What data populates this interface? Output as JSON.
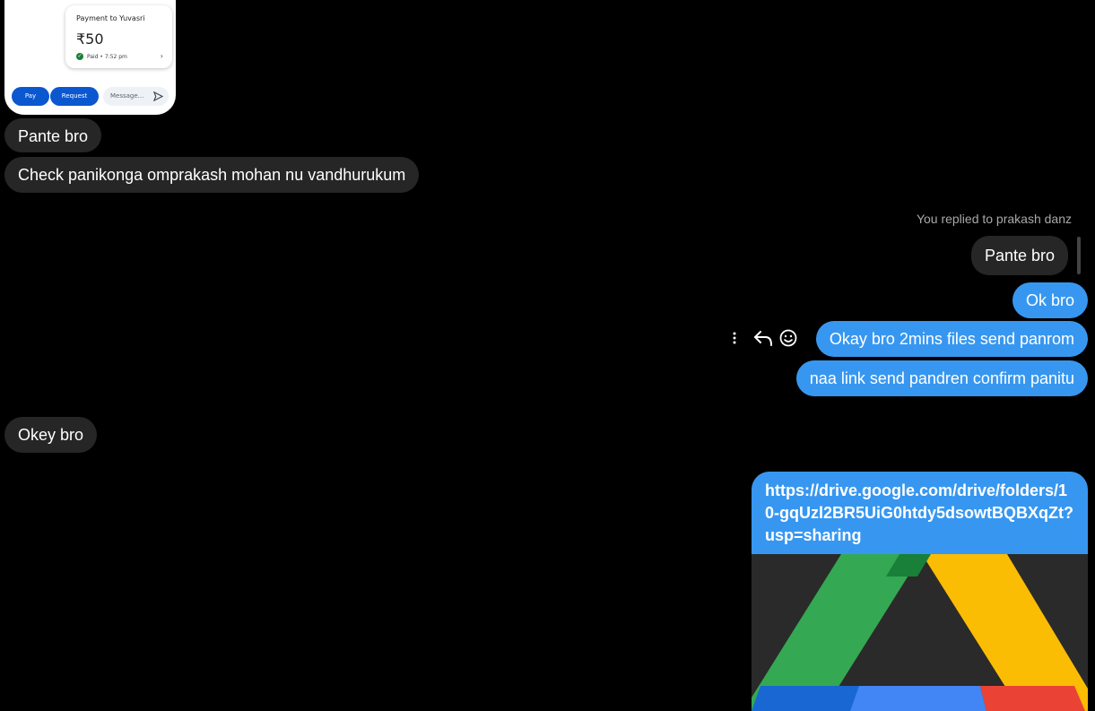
{
  "screenshot_card": {
    "title": "Payment to Yuvasri",
    "amount": "₹50",
    "status": "Paid • 7:52 pm",
    "pay_label": "Pay",
    "request_label": "Request",
    "message_placeholder": "Message..."
  },
  "messages": [
    {
      "sender": "other",
      "text": "Pante bro"
    },
    {
      "sender": "other",
      "text": "Check panikonga omprakash mohan nu vandhurukum"
    },
    {
      "sender": "me",
      "reply_note": "You replied to prakash danz",
      "quoted": "Pante bro"
    },
    {
      "sender": "me",
      "text": "Ok bro"
    },
    {
      "sender": "me",
      "text": "Okay bro 2mins files send panrom"
    },
    {
      "sender": "me",
      "text": "naa link send pandren confirm panitu"
    },
    {
      "sender": "other",
      "text": "Okey bro"
    },
    {
      "sender": "me",
      "text": "https://drive.google.com/drive/folders/10-gqUzl2BR5UiG0htdy5dsowtBQBXqZt?usp=sharing"
    }
  ],
  "message_actions": {
    "icons": [
      "more-options-icon",
      "reply-icon",
      "emoji-react-icon"
    ]
  },
  "colors": {
    "background": "#000000",
    "incoming_bubble": "#262626",
    "outgoing_bubble": "#3797f0",
    "drive_green": "#34a853",
    "drive_yellow": "#fbbc04",
    "drive_blue": "#4285f4",
    "drive_red": "#ea4335"
  }
}
